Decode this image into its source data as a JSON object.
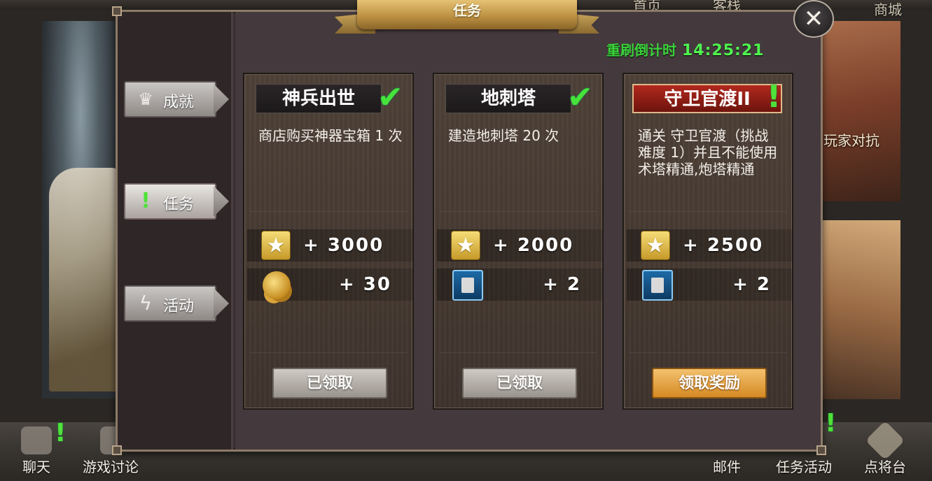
{
  "background": {
    "top_labels": [
      "首页",
      "客栈",
      "商城"
    ],
    "right_label": "玩家对抗",
    "bottom_nav": [
      {
        "label": "聊天",
        "icon": "chat-bubbles-icon",
        "badge": "!"
      },
      {
        "label": "游戏讨论",
        "icon": "users-icon",
        "badge": ""
      },
      {
        "label": "邮件",
        "icon": "mail-icon",
        "badge": ""
      },
      {
        "label": "任务活动",
        "icon": "quest-scroll-icon",
        "badge": "!"
      },
      {
        "label": "点将台",
        "icon": "command-stage-icon",
        "badge": ""
      }
    ]
  },
  "panel": {
    "title": "任务",
    "close_icon": "✕",
    "countdown_label": "重刷倒计时",
    "countdown_time": "14:25:21"
  },
  "tabs": [
    {
      "label": "成就",
      "icon": "crown-icon",
      "glyph": "♛",
      "active": false
    },
    {
      "label": "任务",
      "icon": "quest-eye-icon",
      "glyph": "!",
      "active": true
    },
    {
      "label": "活动",
      "icon": "lightning-icon",
      "glyph": "ϟ",
      "active": false
    }
  ],
  "cards": [
    {
      "title": "神兵出世",
      "status_icon": "✔",
      "description": "商店购买神器宝箱 1 次",
      "rewards": [
        {
          "type": "star",
          "value": "+ 3000"
        },
        {
          "type": "coin",
          "value": "+ 30"
        }
      ],
      "button_label": "已领取",
      "button_state": "claimed"
    },
    {
      "title": "地刺塔",
      "status_icon": "✔",
      "description": "建造地刺塔 20 次",
      "rewards": [
        {
          "type": "star",
          "value": "+ 2000"
        },
        {
          "type": "card",
          "value": "+ 2"
        }
      ],
      "button_label": "已领取",
      "button_state": "claimed"
    },
    {
      "title": "守卫官渡II",
      "status_icon": "!",
      "description": "通关 守卫官渡（挑战难度 1）并且不能使用 术塔精通,炮塔精通",
      "rewards": [
        {
          "type": "star",
          "value": "+ 2500"
        },
        {
          "type": "card",
          "value": "+ 2"
        }
      ],
      "button_label": "领取奖励",
      "button_state": "claimable"
    }
  ],
  "colors": {
    "panel_bg": "#44393d",
    "countdown_green": "#4ff54f",
    "title_gold": "#e6c274",
    "claim_orange": "#d58a23"
  }
}
